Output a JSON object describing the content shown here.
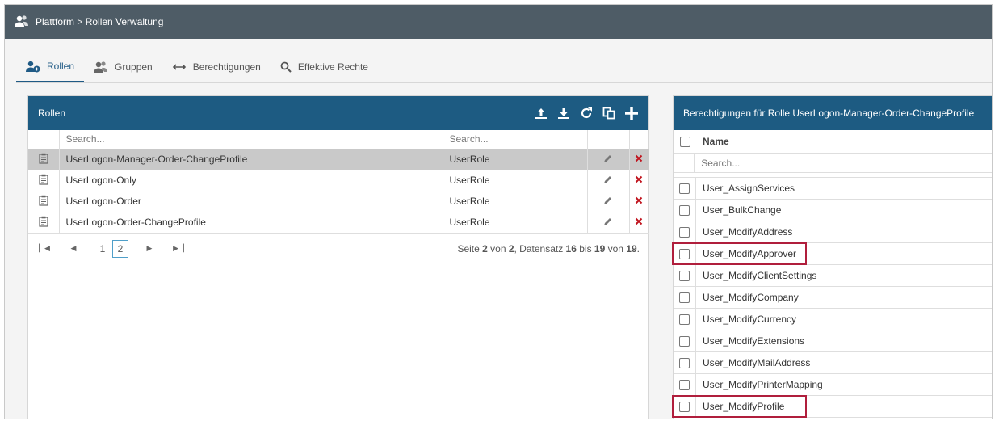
{
  "breadcrumb": "Plattform > Rollen Verwaltung",
  "tabs": [
    {
      "label": "Rollen"
    },
    {
      "label": "Gruppen"
    },
    {
      "label": "Berechtigungen"
    },
    {
      "label": "Effektive Rechte"
    }
  ],
  "roles_panel": {
    "title": "Rollen",
    "search_placeholder_name": "Search...",
    "search_placeholder_type": "Search...",
    "rows": [
      {
        "name": "UserLogon-Manager-Order-ChangeProfile",
        "type": "UserRole"
      },
      {
        "name": "UserLogon-Only",
        "type": "UserRole"
      },
      {
        "name": "UserLogon-Order",
        "type": "UserRole"
      },
      {
        "name": "UserLogon-Order-ChangeProfile",
        "type": "UserRole"
      }
    ],
    "pager": {
      "pages": [
        "1",
        "2"
      ],
      "info_prefix": "Seite ",
      "page": "2",
      "of_label": " von ",
      "total_pages": "2",
      "record_label": ", Datensatz ",
      "from": "16",
      "to_label": " bis ",
      "to": "19",
      "of2_label": " von ",
      "total": "19",
      "end": "."
    }
  },
  "permissions_panel": {
    "title": "Berechtigungen für Rolle UserLogon-Manager-Order-ChangeProfile",
    "column_name": "Name",
    "search_placeholder": "Search...",
    "items": [
      "User_AssignServices",
      "User_BulkChange",
      "User_ModifyAddress",
      "User_ModifyApprover",
      "User_ModifyClientSettings",
      "User_ModifyCompany",
      "User_ModifyCurrency",
      "User_ModifyExtensions",
      "User_ModifyMailAddress",
      "User_ModifyPrinterMapping",
      "User_ModifyProfile"
    ]
  },
  "colors": {
    "topbar": "#4e5c66",
    "panel_header": "#1d5b82",
    "selected_row": "#c9c9c9",
    "delete": "#c0141e",
    "highlight": "#b01e3c"
  }
}
